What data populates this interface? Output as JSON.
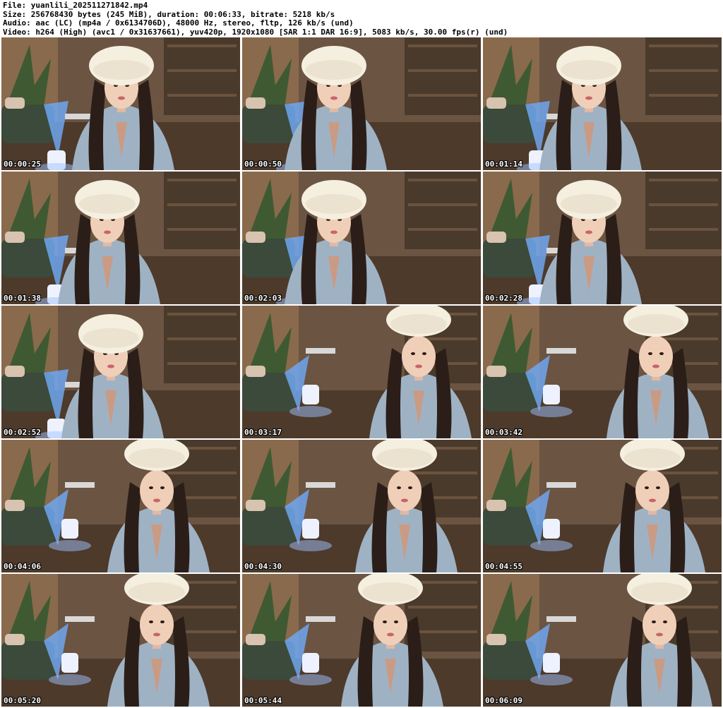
{
  "header": {
    "file_line": "File: yuanlili_202511271842.mp4",
    "size_line": "Size: 256768430 bytes (245 MiB), duration: 00:06:33, bitrate: 5218 kb/s",
    "audio_line": "Audio: aac (LC) (mp4a / 0x6134706D), 48000 Hz, stereo, fltp, 126 kb/s (und)",
    "video_line": "Video: h264 (High) (avc1 / 0x31637661), yuv420p, 1920x1080 [SAR 1:1 DAR 16:9], 5083 kb/s, 30.00 fps(r) (und)"
  },
  "thumbnails": [
    {
      "timestamp": "00:00:25"
    },
    {
      "timestamp": "00:00:50"
    },
    {
      "timestamp": "00:01:14"
    },
    {
      "timestamp": "00:01:38"
    },
    {
      "timestamp": "00:02:03"
    },
    {
      "timestamp": "00:02:28"
    },
    {
      "timestamp": "00:02:52"
    },
    {
      "timestamp": "00:03:17"
    },
    {
      "timestamp": "00:03:42"
    },
    {
      "timestamp": "00:04:06"
    },
    {
      "timestamp": "00:04:30"
    },
    {
      "timestamp": "00:04:55"
    },
    {
      "timestamp": "00:05:20"
    },
    {
      "timestamp": "00:05:44"
    },
    {
      "timestamp": "00:06:09"
    }
  ],
  "colors": {
    "background": "#ffffff",
    "timestamp_text": "#ffffff",
    "header_text": "#000000"
  },
  "icons": [
    "video-frame-thumbnail"
  ]
}
